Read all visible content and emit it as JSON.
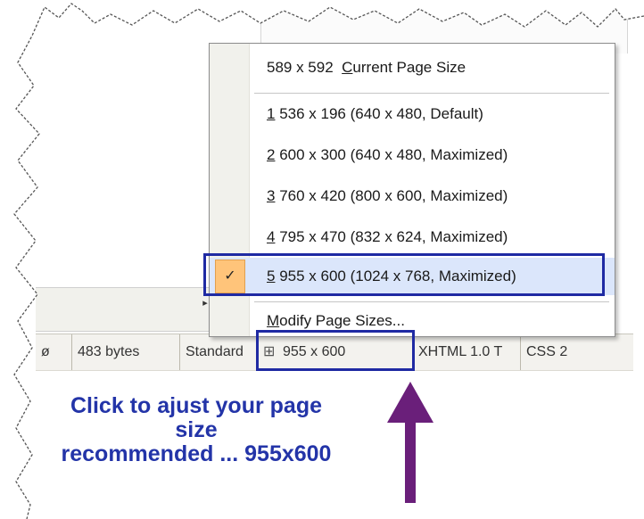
{
  "menu": {
    "current": {
      "num": "",
      "label": "589 x 592",
      "mn": "C",
      "rest": "urrent Page Size"
    },
    "items": [
      {
        "num": "1",
        "label": " 536 x 196  (640 x 480, Default)"
      },
      {
        "num": "2",
        "label": " 600 x 300  (640 x 480, Maximized)"
      },
      {
        "num": "3",
        "label": " 760 x 420  (800 x 600, Maximized)"
      },
      {
        "num": "4",
        "label": " 795 x 470  (832 x 624, Maximized)"
      },
      {
        "num": "5",
        "label": " 955 x 600  (1024 x 768, Maximized)"
      }
    ],
    "check_mark": "✓",
    "modify": {
      "mn": "M",
      "rest": "odify Page Sizes..."
    }
  },
  "status_bar": {
    "cells": [
      "ø",
      "483 bytes",
      "Standard",
      "955 x 600",
      "XHTML 1.0 T",
      "CSS 2"
    ],
    "page_size_icon": "page-size-icon"
  },
  "annotation": {
    "line1": "Click to ajust your page",
    "line2": "size",
    "line3": "recommended ... 955x600"
  },
  "colors": {
    "highlight": "#1f2aa3",
    "annotation_text": "#2334a8",
    "arrow": "#6a1f7a",
    "checked_bg": "#ffc47a"
  }
}
